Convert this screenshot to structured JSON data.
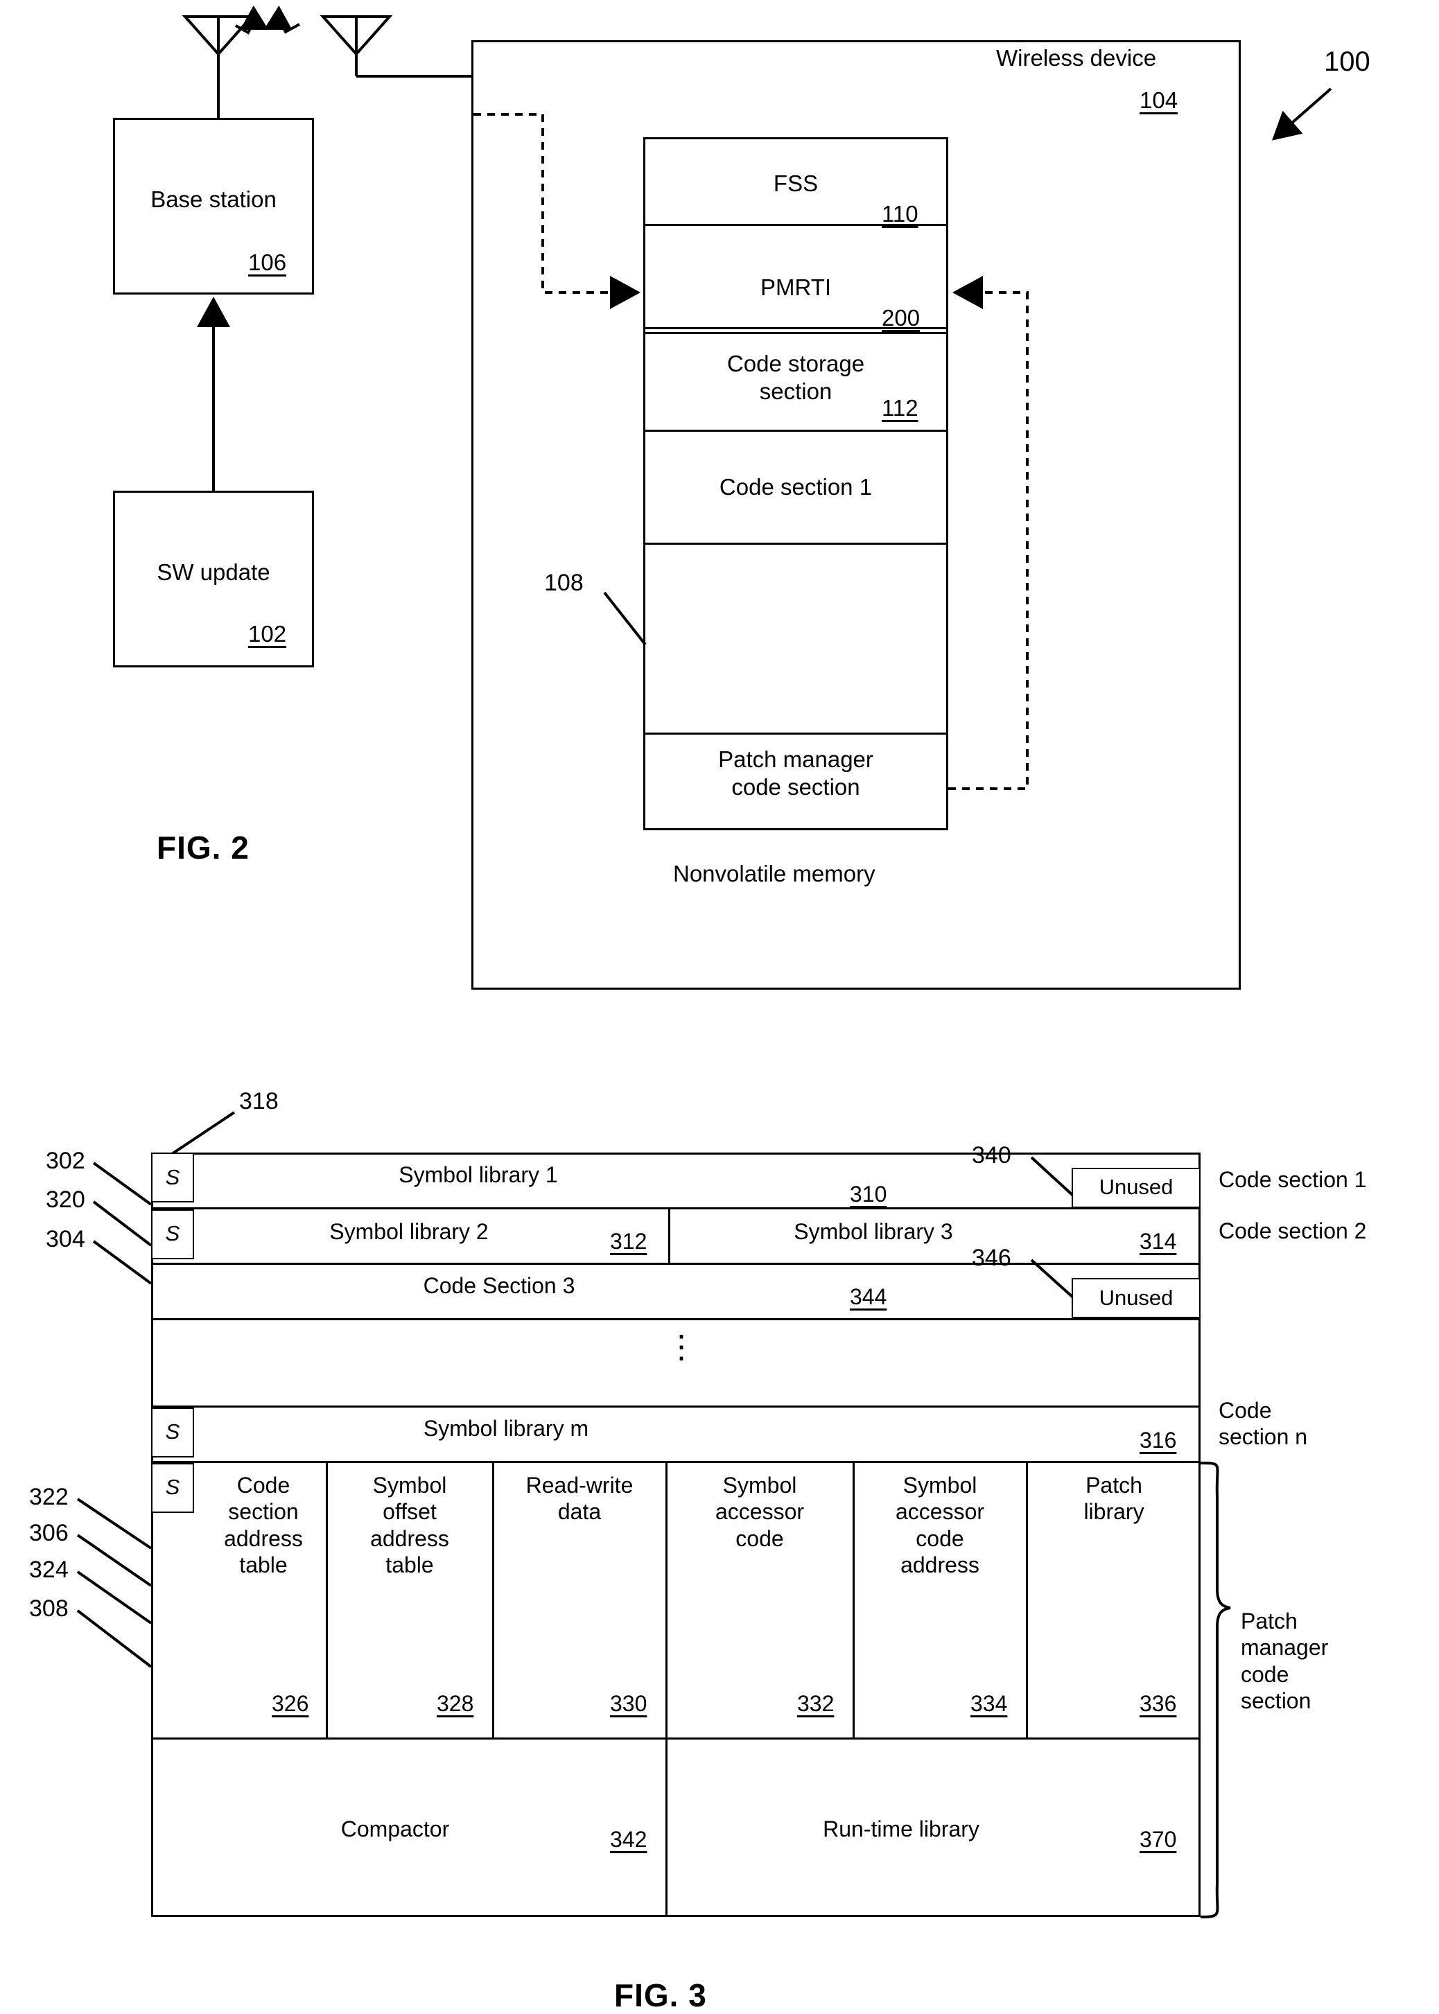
{
  "figures": [
    {
      "id": "fig2",
      "label": "FIG. 2"
    },
    {
      "id": "fig3",
      "label": "FIG. 3"
    }
  ],
  "fig2": {
    "label": "FIG. 2",
    "system_ref": "100",
    "base_station": {
      "title": "Base station",
      "ref": "106"
    },
    "sw_update": {
      "title": "SW update",
      "ref": "102"
    },
    "wireless_device": {
      "title": "Wireless device",
      "ref": "104"
    },
    "nonvolatile_memory": {
      "caption": "Nonvolatile memory",
      "ref": "108"
    },
    "memory_blocks": [
      {
        "title": "FSS",
        "ref": "110"
      },
      {
        "title": "PMRTI",
        "ref": "200"
      },
      {
        "title": "Code storage\nsection",
        "ref": "112"
      },
      {
        "title": "Code section 1",
        "ref": ""
      },
      {
        "title": "",
        "ref": ""
      },
      {
        "title": "Patch manager\ncode section",
        "ref": ""
      }
    ],
    "icons": {
      "antenna_base": "antenna-icon",
      "antenna_device": "antenna-icon",
      "rf_link": "wireless-link-icon"
    }
  },
  "fig3": {
    "label": "FIG. 3",
    "symbol_marker": "S",
    "symbol_marker_ref": "318",
    "left_refs": [
      "302",
      "320",
      "304",
      "322",
      "306",
      "324",
      "308"
    ],
    "rows": [
      {
        "name": "code-section-1",
        "right_label": "Code section 1",
        "cells": [
          {
            "text": "Symbol library 1",
            "ref": "310"
          },
          {
            "text": "Unused",
            "ref": "340"
          }
        ]
      },
      {
        "name": "code-section-2",
        "right_label": "Code section 2",
        "cells": [
          {
            "text": "Symbol library 2",
            "ref": "312"
          },
          {
            "text": "Symbol library 3",
            "ref": "314"
          }
        ]
      },
      {
        "name": "code-section-3",
        "right_label": "",
        "cells": [
          {
            "text": "Code Section 3",
            "ref": "344"
          },
          {
            "text": "Unused",
            "ref": "346"
          }
        ]
      },
      {
        "name": "ellipsis-row",
        "right_label": "",
        "cells": [
          {
            "text": "",
            "ref": ""
          }
        ]
      },
      {
        "name": "code-section-n",
        "right_label": "Code\nsection n",
        "cells": [
          {
            "text": "Symbol library m",
            "ref": "316"
          }
        ]
      }
    ],
    "patch_manager": {
      "right_label": "Patch\nmanager\ncode\nsection",
      "columns": [
        {
          "text": "Code\nsection\naddress\ntable",
          "ref": "326"
        },
        {
          "text": "Symbol\noffset\naddress\ntable",
          "ref": "328"
        },
        {
          "text": "Read-write\ndata",
          "ref": "330"
        },
        {
          "text": "Symbol\naccessor\ncode",
          "ref": "332"
        },
        {
          "text": "Symbol\naccessor\ncode\naddress",
          "ref": "334"
        },
        {
          "text": "Patch\nlibrary",
          "ref": "336"
        }
      ],
      "bottom_row": [
        {
          "text": "Compactor",
          "ref": "342"
        },
        {
          "text": "Run-time library",
          "ref": "370"
        }
      ]
    }
  }
}
